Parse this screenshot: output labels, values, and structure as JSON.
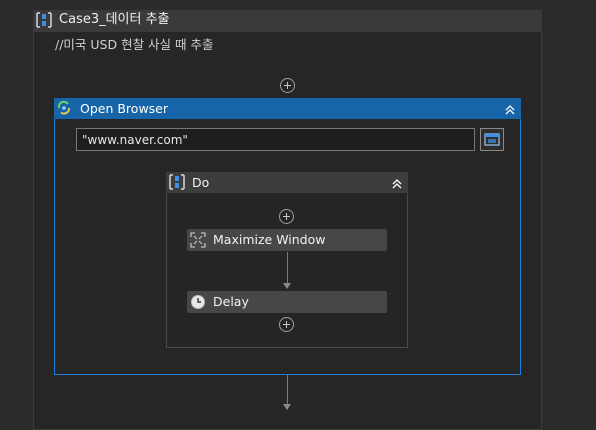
{
  "sequence": {
    "title": "Case3_데이터 추출",
    "comment": "//미국 USD 현찰 사실 때 추출"
  },
  "open_browser": {
    "title": "Open Browser",
    "url_value": "\"www.naver.com\""
  },
  "do_block": {
    "title": "Do",
    "activities": [
      {
        "label": "Maximize Window",
        "icon": "maximize-icon"
      },
      {
        "label": "Delay",
        "icon": "clock-icon"
      }
    ]
  },
  "colors": {
    "accent": "#1f7fd6",
    "header_blue": "#1765a8",
    "background": "#2b2b2b"
  }
}
